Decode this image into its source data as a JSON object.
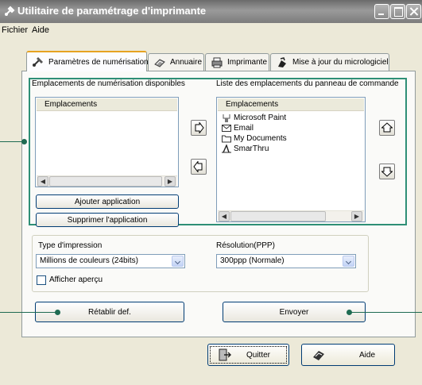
{
  "window": {
    "title": "Utilitaire de paramétrage d'imprimante",
    "menu": [
      "Fichier",
      "Aide"
    ]
  },
  "tabs": [
    {
      "label": "Paramètres de numérisation",
      "icon": "scan-settings-icon",
      "active": true
    },
    {
      "label": "Annuaire",
      "icon": "address-book-icon",
      "active": false
    },
    {
      "label": "Imprimante",
      "icon": "printer-icon",
      "active": false
    },
    {
      "label": "Mise à jour du micrologiciel",
      "icon": "firmware-update-icon",
      "active": false
    }
  ],
  "scan_locations": {
    "available_label": "Emplacements de numérisation disponibles",
    "panel_list_label": "Liste des emplacements du panneau de commande",
    "available_header": "Emplacements",
    "panel_header": "Emplacements",
    "available_items": [],
    "panel_items": [
      {
        "label": "Microsoft Paint",
        "icon": "paint-brush-icon"
      },
      {
        "label": "Email",
        "icon": "envelope-icon"
      },
      {
        "label": "My Documents",
        "icon": "folder-icon"
      },
      {
        "label": "SmarThru",
        "icon": "smarthru-icon"
      }
    ],
    "add_button": "Ajouter application",
    "remove_button": "Supprimer l'application"
  },
  "options": {
    "print_type_label": "Type d'impression",
    "print_type_value": "Millions de couleurs (24bits)",
    "resolution_label": "Résolution(PPP)",
    "resolution_value": "300ppp (Normale)",
    "preview_label": "Afficher aperçu",
    "preview_checked": false
  },
  "actions": {
    "reset": "Rétablir def.",
    "send": "Envoyer",
    "quit": "Quitter",
    "help": "Aide"
  },
  "colors": {
    "group_border": "#2e8f76",
    "callout": "#1e6b52",
    "title_bar": "#7c7c7c"
  }
}
